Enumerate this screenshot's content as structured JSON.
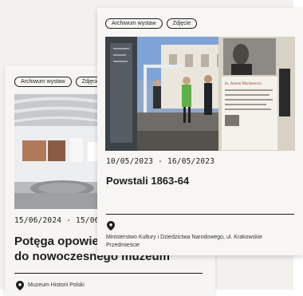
{
  "background_color": "#f3f1ee",
  "back_card": {
    "tags": [
      "Archiwum wystaw",
      "Zdjęcie"
    ],
    "date_range": "15/06/2024 - 15/06/2024",
    "title_line1": "Potęga opowieści. Od opowieści",
    "title_line2": "do nowoczesnego muzeum",
    "location_icon": "map-pin-icon",
    "location": "Muzeum Historii Polski"
  },
  "front_card": {
    "tags": [
      "Archiwum wystaw",
      "Zdjęcie"
    ],
    "date_range": "10/05/2023 - 16/05/2023",
    "title": "Powstali 1863-64",
    "location_icon": "map-pin-icon",
    "location": "Ministerstwo Kultury i Dziedzictwa Narodowego, ul. Krakowskie Przedmieście",
    "panel_heading": "Apolinary Mackiewicz"
  }
}
